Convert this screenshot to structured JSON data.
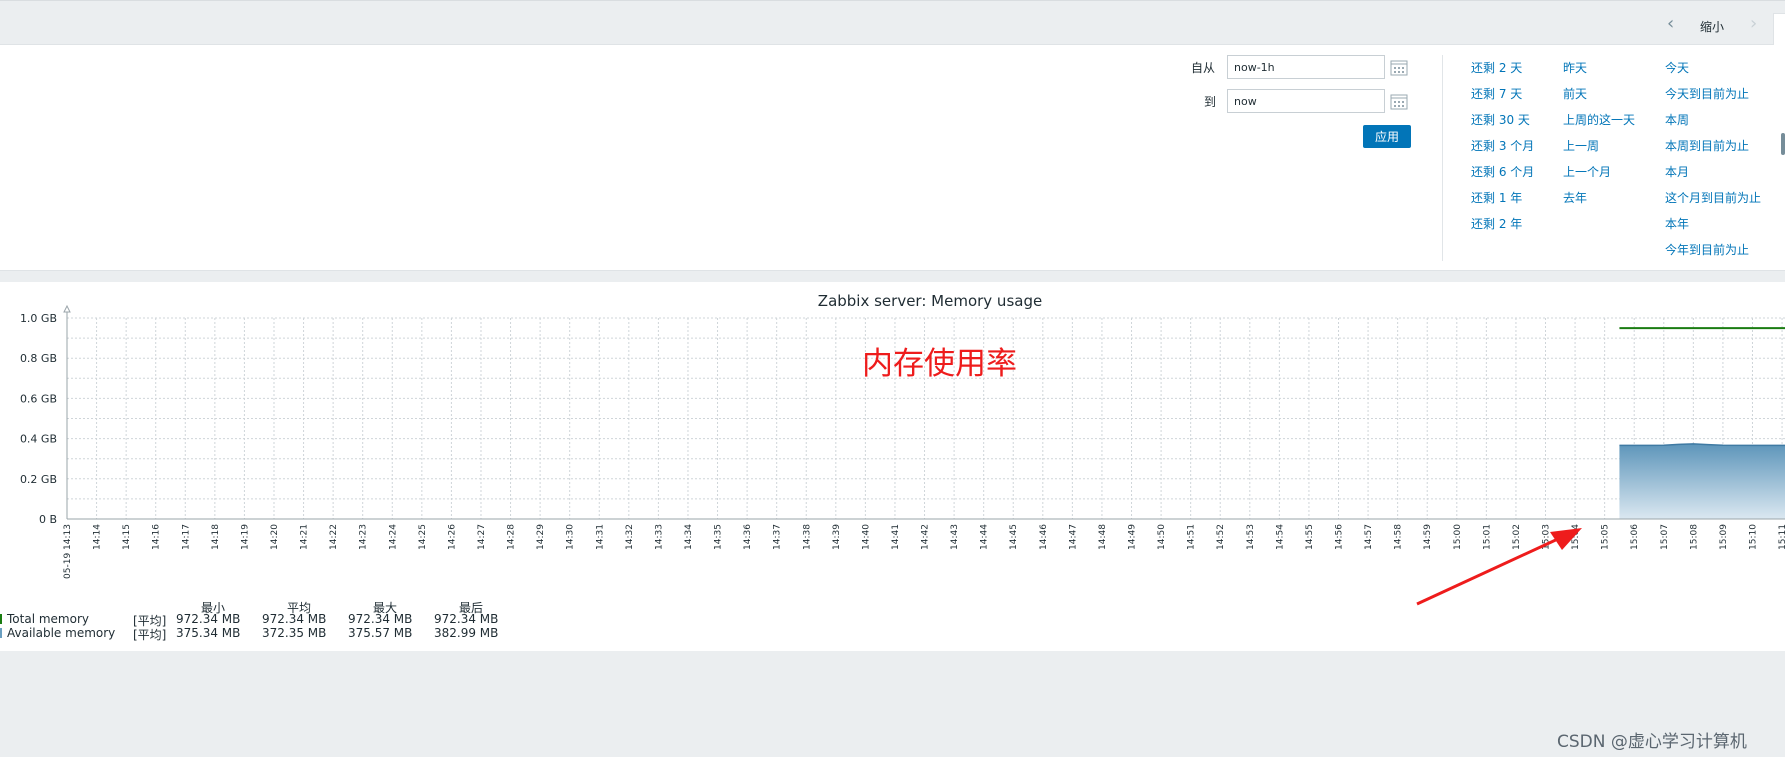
{
  "topbar": {
    "prev_icon": "chevron-left-icon",
    "next_icon": "chevron-right-icon",
    "zoom_out_label": "缩小"
  },
  "filter": {
    "from_label": "自从",
    "from_value": "now-1h",
    "to_label": "到",
    "to_value": "now",
    "apply_label": "应用",
    "calendar_icon": "calendar-icon",
    "quick": [
      [
        "还剩 2 天",
        "还剩 7 天",
        "还剩 30 天",
        "还剩 3 个月",
        "还剩 6 个月",
        "还剩 1 年",
        "还剩 2 年"
      ],
      [
        "昨天",
        "前天",
        "上周的这一天",
        "上一周",
        "上一个月",
        "去年"
      ],
      [
        "今天",
        "今天到目前为止",
        "本周",
        "本周到目前为止",
        "本月",
        "这个月到目前为止",
        "本年",
        "今年到目前为止"
      ]
    ]
  },
  "graph": {
    "annotation": "内存使用率"
  },
  "chart_data": {
    "type": "area",
    "title": "Zabbix server: Memory usage",
    "ylabel": "",
    "xlabel": "",
    "ylim": [
      0,
      1.0
    ],
    "y_ticks": [
      "0 B",
      "0.2 GB",
      "0.4 GB",
      "0.6 GB",
      "0.8 GB",
      "1.0 GB"
    ],
    "x_start_label": "05-19 14:13",
    "x_ticks": [
      "14:14",
      "14:15",
      "14:16",
      "14:17",
      "14:18",
      "14:19",
      "14:20",
      "14:21",
      "14:22",
      "14:23",
      "14:24",
      "14:25",
      "14:26",
      "14:27",
      "14:28",
      "14:29",
      "14:30",
      "14:31",
      "14:32",
      "14:33",
      "14:34",
      "14:35",
      "14:36",
      "14:37",
      "14:38",
      "14:39",
      "14:40",
      "14:41",
      "14:42",
      "14:43",
      "14:44",
      "14:45",
      "14:46",
      "14:47",
      "14:48",
      "14:49",
      "14:50",
      "14:51",
      "14:52",
      "14:53",
      "14:54",
      "14:55",
      "14:56",
      "14:57",
      "14:58",
      "14:59",
      "15:00",
      "15:01",
      "15:02",
      "15:03",
      "15:04",
      "15:05",
      "15:06",
      "15:07",
      "15:08",
      "15:09",
      "15:10",
      "15:11"
    ],
    "highlight_tick": "15:00",
    "series": [
      {
        "name": "Total memory",
        "color": "#1a7c11",
        "style": "line",
        "x": [
          "15:05:30",
          "15:13"
        ],
        "y": [
          0.9495,
          0.9495
        ]
      },
      {
        "name": "Available memory",
        "color": "#6a9fc1",
        "style": "area",
        "x": [
          "15:05:30",
          "15:06",
          "15:07",
          "15:07:30",
          "15:08",
          "15:08:30",
          "15:09",
          "15:10",
          "15:11",
          "15:13"
        ],
        "y": [
          0.366,
          0.366,
          0.367,
          0.371,
          0.374,
          0.37,
          0.367,
          0.366,
          0.366,
          0.366
        ]
      }
    ],
    "grid": true
  },
  "legend": {
    "headers": [
      "最小",
      "平均",
      "最大",
      "最后"
    ],
    "rows": [
      {
        "name": "Total memory",
        "color": "#1a7c11",
        "func": "[平均]",
        "values": [
          "972.34 MB",
          "972.34 MB",
          "972.34 MB",
          "972.34 MB"
        ]
      },
      {
        "name": "Available memory",
        "color": "#6a9fc1",
        "func": "[平均]",
        "values": [
          "375.34 MB",
          "372.35 MB",
          "375.57 MB",
          "382.99 MB"
        ]
      }
    ]
  },
  "watermark": "CSDN @虚心学习计算机"
}
